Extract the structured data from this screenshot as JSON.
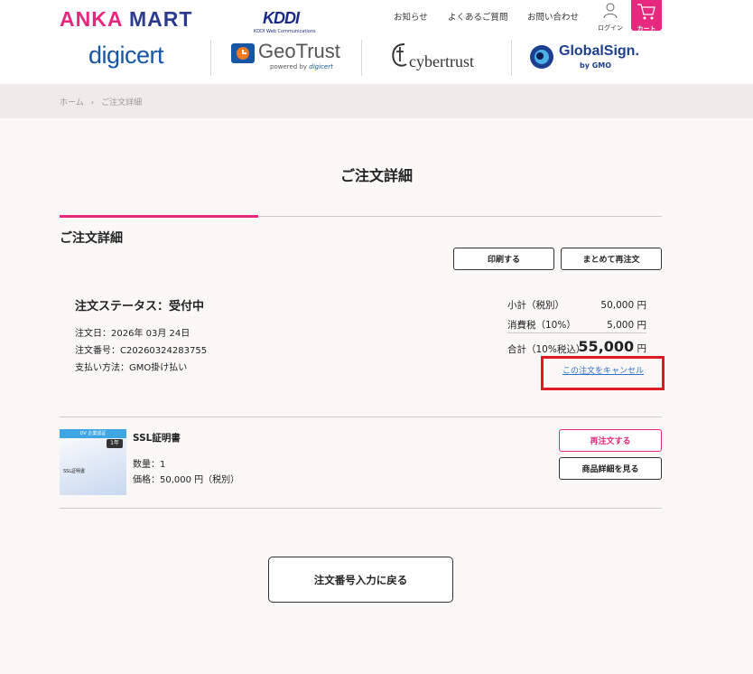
{
  "header": {
    "logo_left": "ANKA",
    "logo_right": "MART",
    "kddi_mark": "KDDI",
    "kddi_sub": "KDDI Web Communications",
    "nav": [
      "お知らせ",
      "よくあるご質問",
      "お問い合わせ"
    ],
    "login_label": "ログイン",
    "cart_label": "カート",
    "accent_color": "#e6287e"
  },
  "brands": {
    "digicert": "digicert",
    "geotrust": "GeoTrust",
    "geotrust_sub": "powered by",
    "geotrust_sub_brand": "digicert",
    "cybertrust": "cybertrust",
    "globalsign": "GlobalSign.",
    "globalsign_sub": "by GMO"
  },
  "breadcrumb": {
    "home": "ホーム",
    "sep": "›",
    "current": "ご注文詳細"
  },
  "page_title": "ご注文詳細",
  "section_title": "ご注文詳細",
  "actions": {
    "print": "印刷する",
    "reorder_all": "まとめて再注文"
  },
  "order": {
    "status": "注文ステータス：受付中",
    "date": "注文日：2026年 03月 24日",
    "number": "注文番号：C20260324283755",
    "payment": "支払い方法：GMO掛け払い",
    "subtotal_label": "小計（税別）",
    "subtotal": "50,000 円",
    "tax_label": "消費税（10%）",
    "tax": "5,000 円",
    "total_label": "合計（10%税込）",
    "total_amount": "55,000",
    "total_unit": "円",
    "cancel_link": "この注文をキャンセル",
    "highlight_color": "#e01a22"
  },
  "product": {
    "thumb_band": "DV 企業認証",
    "thumb_badge": "1年",
    "thumb_label": "SSL証明書",
    "name": "SSL証明書",
    "quantity": "数量：1",
    "price": "価格：50,000 円（税別）",
    "reorder": "再注文する",
    "detail": "商品詳細を見る"
  },
  "back_button": "注文番号入力に戻る"
}
